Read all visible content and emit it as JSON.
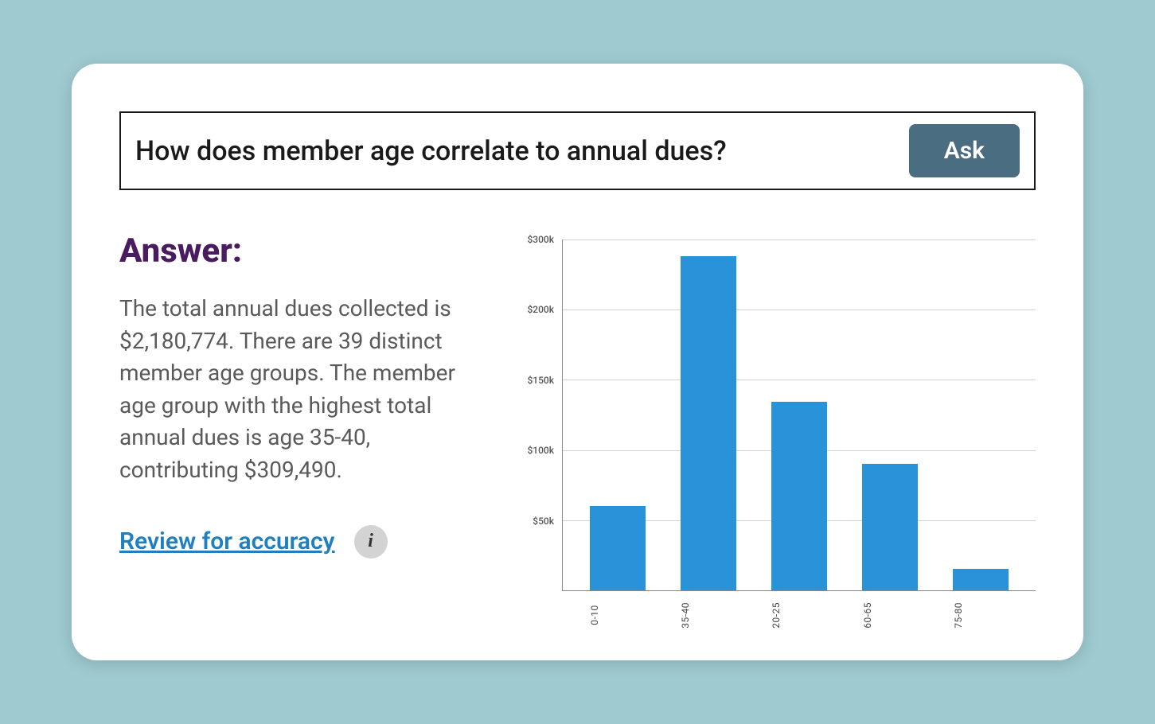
{
  "query": {
    "text": "How does member age correlate to annual dues?",
    "ask_label": "Ask"
  },
  "answer": {
    "heading": "Answer:",
    "body": "The total annual dues collected is $2,180,774. There are 39 distinct member age groups. The member age group with the highest total annual dues is age 35-40, contributing $309,490.",
    "review_label": "Review for accuracy",
    "info_glyph": "i"
  },
  "chart_data": {
    "type": "bar",
    "categories": [
      "0-10",
      "35-40",
      "20-25",
      "60-65",
      "75-80"
    ],
    "values": [
      78000,
      309490,
      175000,
      117000,
      20000
    ],
    "title": "",
    "xlabel": "",
    "ylabel": "",
    "ylim": [
      0,
      325000
    ],
    "y_ticks": [
      "$300k",
      "$200k",
      "$150k",
      "$100k",
      "$50k",
      ""
    ],
    "bar_color": "#2893d8"
  }
}
